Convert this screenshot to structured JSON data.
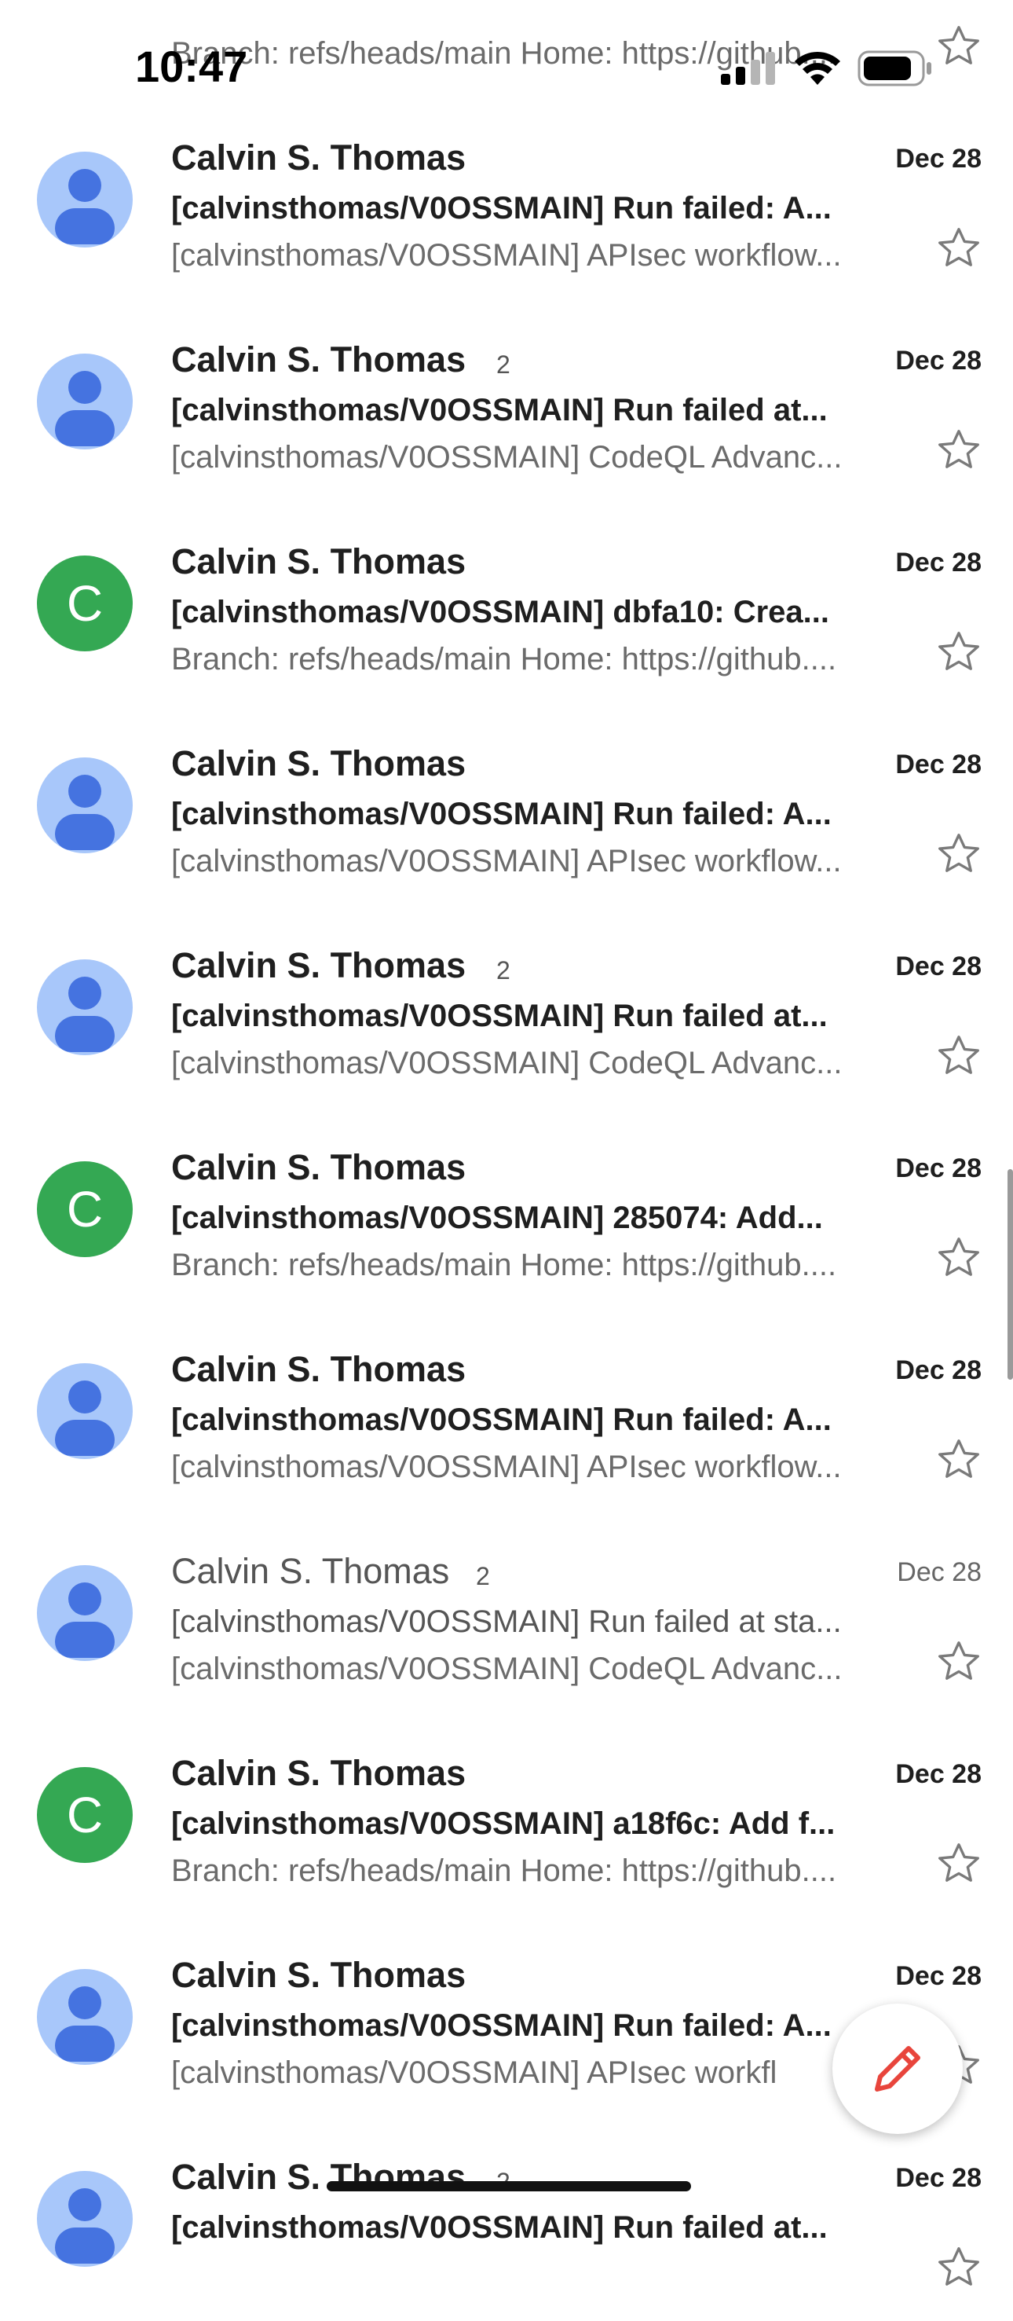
{
  "status_bar": {
    "time": "10:47"
  },
  "colors": {
    "avatar_person_bg": "#a8c7fa",
    "avatar_person_fg": "#4573e0",
    "avatar_letter_bg": "#34a853",
    "compose_icon": "#e8453c"
  },
  "icons": {
    "star": "star-outline-icon",
    "compose": "pencil-icon",
    "signal": "signal-icon",
    "wifi": "wifi-icon",
    "battery": "battery-icon"
  },
  "emails": [
    {
      "sender": "",
      "count": "",
      "date": "",
      "subject": "",
      "snippet": "Branch: refs/heads/main Home: https://github....",
      "avatar": "none",
      "unread": true
    },
    {
      "sender": "Calvin S. Thomas",
      "count": "",
      "date": "Dec 28",
      "subject": "[calvinsthomas/V0OSSMAIN] Run failed: A...",
      "snippet": "[calvinsthomas/V0OSSMAIN] APIsec workflow...",
      "avatar": "person",
      "unread": true
    },
    {
      "sender": "Calvin S. Thomas",
      "count": "2",
      "date": "Dec 28",
      "subject": "[calvinsthomas/V0OSSMAIN] Run failed at...",
      "snippet": "[calvinsthomas/V0OSSMAIN] CodeQL Advanc...",
      "avatar": "person",
      "unread": true
    },
    {
      "sender": "Calvin S. Thomas",
      "count": "",
      "date": "Dec 28",
      "subject": "[calvinsthomas/V0OSSMAIN] dbfa10: Crea...",
      "snippet": "Branch: refs/heads/main Home: https://github....",
      "avatar": "C",
      "unread": true
    },
    {
      "sender": "Calvin S. Thomas",
      "count": "",
      "date": "Dec 28",
      "subject": "[calvinsthomas/V0OSSMAIN] Run failed: A...",
      "snippet": "[calvinsthomas/V0OSSMAIN] APIsec workflow...",
      "avatar": "person",
      "unread": true
    },
    {
      "sender": "Calvin S. Thomas",
      "count": "2",
      "date": "Dec 28",
      "subject": "[calvinsthomas/V0OSSMAIN] Run failed at...",
      "snippet": "[calvinsthomas/V0OSSMAIN] CodeQL Advanc...",
      "avatar": "person",
      "unread": true
    },
    {
      "sender": "Calvin S. Thomas",
      "count": "",
      "date": "Dec 28",
      "subject": "[calvinsthomas/V0OSSMAIN] 285074: Add...",
      "snippet": "Branch: refs/heads/main Home: https://github....",
      "avatar": "C",
      "unread": true
    },
    {
      "sender": "Calvin S. Thomas",
      "count": "",
      "date": "Dec 28",
      "subject": "[calvinsthomas/V0OSSMAIN] Run failed: A...",
      "snippet": "[calvinsthomas/V0OSSMAIN] APIsec workflow...",
      "avatar": "person",
      "unread": true
    },
    {
      "sender": "Calvin S. Thomas",
      "count": "2",
      "date": "Dec 28",
      "subject": "[calvinsthomas/V0OSSMAIN] Run failed at sta...",
      "snippet": "[calvinsthomas/V0OSSMAIN] CodeQL Advanc...",
      "avatar": "person",
      "unread": false
    },
    {
      "sender": "Calvin S. Thomas",
      "count": "",
      "date": "Dec 28",
      "subject": "[calvinsthomas/V0OSSMAIN] a18f6c: Add f...",
      "snippet": "Branch: refs/heads/main Home: https://github....",
      "avatar": "C",
      "unread": true
    },
    {
      "sender": "Calvin S. Thomas",
      "count": "",
      "date": "Dec 28",
      "subject": "[calvinsthomas/V0OSSMAIN] Run failed: A...",
      "snippet": "[calvinsthomas/V0OSSMAIN] APIsec workfl",
      "avatar": "person",
      "unread": true
    },
    {
      "sender": "Calvin S. Thomas",
      "count": "2",
      "date": "Dec 28",
      "subject": "[calvinsthomas/V0OSSMAIN] Run failed at...",
      "snippet": "",
      "avatar": "person",
      "unread": true
    }
  ]
}
